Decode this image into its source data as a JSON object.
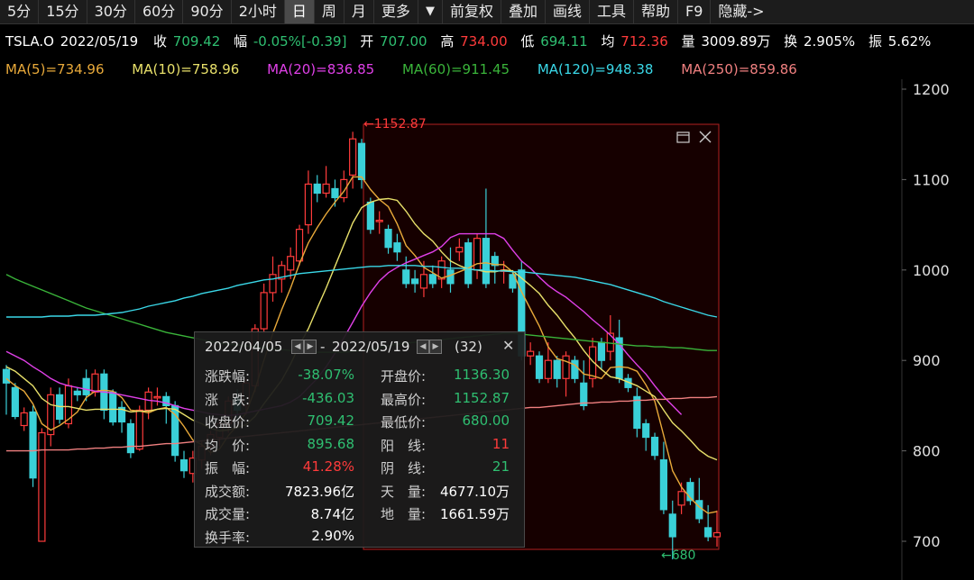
{
  "toolbar": {
    "periods": [
      "5分",
      "15分",
      "30分",
      "60分",
      "90分",
      "2小时",
      "日",
      "周",
      "月",
      "更多"
    ],
    "active": "日",
    "dropdown": "▼",
    "tools": [
      "前复权",
      "叠加",
      "画线",
      "工具",
      "帮助",
      "F9",
      "隐藏->"
    ]
  },
  "quote": {
    "symbol": "TSLA.O",
    "date": "2022/05/19",
    "close_label": "收",
    "close": "709.42",
    "change_label": "幅",
    "change": "-0.05%[-0.39]",
    "open_label": "开",
    "open": "707.00",
    "high_label": "高",
    "high": "734.00",
    "low_label": "低",
    "low": "694.11",
    "avg_label": "均",
    "avg": "712.36",
    "volume_label": "量",
    "volume": "3009.89万",
    "turnover_label": "换",
    "turnover": "2.905%",
    "amplitude_label": "振",
    "amplitude": "5.62%"
  },
  "ma_labels": [
    {
      "text": "MA(5)=734.96",
      "color": "#e8a93a"
    },
    {
      "text": "MA(10)=758.96",
      "color": "#e8e06a"
    },
    {
      "text": "MA(20)=836.85",
      "color": "#e040e8"
    },
    {
      "text": "MA(60)=911.45",
      "color": "#3ab43a"
    },
    {
      "text": "MA(120)=948.38",
      "color": "#3ad8e8"
    },
    {
      "text": "MA(250)=859.86",
      "color": "#f08080"
    }
  ],
  "colors": {
    "up": "#ff3b3b",
    "down": "#3ad0d8",
    "green_text": "#2fbf71",
    "red_text": "#ff3b3b"
  },
  "markers": {
    "high": "←1152.87",
    "low": "←680"
  },
  "chart_data": {
    "type": "candlestick",
    "ylim": [
      680,
      1200
    ],
    "yticks": [
      1200,
      1100,
      1000,
      900,
      800,
      700
    ],
    "candles": [
      [
        890,
        875,
        895,
        840
      ],
      [
        870,
        838,
        875,
        835
      ],
      [
        828,
        842,
        848,
        822
      ],
      [
        843,
        770,
        850,
        760
      ],
      [
        700,
        820,
        825,
        700
      ],
      [
        818,
        862,
        870,
        805
      ],
      [
        862,
        835,
        870,
        830
      ],
      [
        830,
        872,
        880,
        825
      ],
      [
        866,
        862,
        870,
        855
      ],
      [
        880,
        862,
        890,
        855
      ],
      [
        865,
        885,
        890,
        860
      ],
      [
        885,
        845,
        890,
        835
      ],
      [
        865,
        832,
        868,
        828
      ],
      [
        848,
        832,
        855,
        820
      ],
      [
        830,
        798,
        835,
        792
      ],
      [
        802,
        845,
        850,
        800
      ],
      [
        845,
        865,
        870,
        835
      ],
      [
        860,
        860,
        870,
        850
      ],
      [
        860,
        850,
        865,
        830
      ],
      [
        850,
        795,
        855,
        788
      ],
      [
        790,
        778,
        800,
        770
      ],
      [
        775,
        792,
        800,
        765
      ],
      [
        790,
        805,
        810,
        780
      ],
      [
        805,
        818,
        822,
        795
      ],
      [
        815,
        830,
        835,
        805
      ],
      [
        830,
        855,
        860,
        820
      ],
      [
        858,
        845,
        868,
        835
      ],
      [
        850,
        875,
        880,
        840
      ],
      [
        872,
        935,
        940,
        865
      ],
      [
        935,
        975,
        985,
        930
      ],
      [
        975,
        995,
        1015,
        965
      ],
      [
        990,
        1005,
        1010,
        975
      ],
      [
        1000,
        1015,
        1025,
        990
      ],
      [
        1010,
        1045,
        1050,
        1005
      ],
      [
        1050,
        1095,
        1110,
        1040
      ],
      [
        1095,
        1085,
        1105,
        1075
      ],
      [
        1085,
        1095,
        1115,
        1080
      ],
      [
        1090,
        1080,
        1100,
        1070
      ],
      [
        1080,
        1100,
        1110,
        1075
      ],
      [
        1105,
        1145,
        1152.87,
        1090
      ],
      [
        1140,
        1100,
        1145,
        1090
      ],
      [
        1075,
        1045,
        1080,
        1040
      ],
      [
        1055,
        1055,
        1065,
        1040
      ],
      [
        1045,
        1025,
        1050,
        1018
      ],
      [
        1030,
        1020,
        1040,
        1010
      ],
      [
        1000,
        985,
        1015,
        980
      ],
      [
        990,
        985,
        1000,
        975
      ],
      [
        980,
        995,
        1010,
        970
      ],
      [
        995,
        985,
        1005,
        980
      ],
      [
        990,
        1010,
        1015,
        980
      ],
      [
        1000,
        985,
        1025,
        975
      ],
      [
        1020,
        1025,
        1035,
        1010
      ],
      [
        1030,
        985,
        1035,
        980
      ],
      [
        1000,
        1035,
        1040,
        990
      ],
      [
        1035,
        985,
        1090,
        980
      ],
      [
        1015,
        1005,
        1020,
        985
      ],
      [
        1000,
        1000,
        1010,
        985
      ],
      [
        995,
        980,
        1000,
        975
      ],
      [
        1000,
        905,
        1010,
        900
      ],
      [
        905,
        910,
        920,
        895
      ],
      [
        905,
        880,
        910,
        875
      ],
      [
        880,
        900,
        920,
        875
      ],
      [
        900,
        880,
        905,
        870
      ],
      [
        880,
        905,
        910,
        860
      ],
      [
        900,
        880,
        905,
        875
      ],
      [
        875,
        850,
        900,
        845
      ],
      [
        880,
        915,
        925,
        870
      ],
      [
        920,
        900,
        925,
        890
      ],
      [
        910,
        930,
        950,
        900
      ],
      [
        925,
        880,
        945,
        875
      ],
      [
        880,
        870,
        885,
        865
      ],
      [
        860,
        825,
        870,
        815
      ],
      [
        830,
        815,
        835,
        800
      ],
      [
        815,
        795,
        820,
        790
      ],
      [
        790,
        735,
        810,
        730
      ],
      [
        730,
        705,
        745,
        680
      ],
      [
        740,
        755,
        765,
        730
      ],
      [
        765,
        745,
        770,
        740
      ],
      [
        745,
        725,
        770,
        720
      ],
      [
        715,
        705,
        740,
        700
      ],
      [
        705,
        709.42,
        734,
        694.11
      ]
    ],
    "ma": [
      {
        "name": "MA(5)",
        "color": "#e8a93a",
        "values": [
          880,
          872,
          866,
          852,
          830,
          823,
          828,
          835,
          843,
          859,
          866,
          867,
          866,
          859,
          845,
          844,
          842,
          846,
          848,
          840,
          827,
          812,
          807,
          798,
          802,
          817,
          828,
          842,
          868,
          900,
          930,
          956,
          980,
          1007,
          1030,
          1047,
          1062,
          1075,
          1087,
          1103,
          1103,
          1089,
          1078,
          1070,
          1051,
          1027,
          1016,
          1003,
          997,
          991,
          994,
          998,
          1002,
          1007,
          1008,
          1006,
          1006,
          998,
          976,
          957,
          938,
          915,
          902,
          899,
          895,
          885,
          883,
          880,
          892,
          893,
          892,
          888,
          873,
          855,
          817,
          778,
          760,
          748,
          738,
          731,
          733
        ]
      },
      {
        "name": "MA(10)",
        "color": "#e8e06a",
        "values": [
          893,
          888,
          880,
          872,
          858,
          851,
          849,
          849,
          847,
          845,
          846,
          846,
          846,
          846,
          843,
          844,
          844,
          846,
          847,
          846,
          840,
          834,
          830,
          825,
          822,
          823,
          826,
          829,
          838,
          852,
          865,
          878,
          896,
          917,
          935,
          958,
          980,
          1004,
          1028,
          1052,
          1069,
          1075,
          1078,
          1079,
          1077,
          1065,
          1051,
          1040,
          1032,
          1020,
          1010,
          1005,
          1001,
          1000,
          998,
          998,
          1000,
          999,
          991,
          983,
          974,
          961,
          950,
          937,
          925,
          911,
          899,
          890,
          882,
          880,
          876,
          872,
          866,
          860,
          845,
          831,
          822,
          812,
          801,
          794,
          790
        ]
      },
      {
        "name": "MA(20)",
        "color": "#e040e8",
        "values": [
          910,
          905,
          900,
          893,
          887,
          880,
          875,
          872,
          870,
          868,
          866,
          865,
          864,
          862,
          860,
          858,
          856,
          855,
          853,
          850,
          847,
          845,
          843,
          841,
          840,
          839,
          840,
          842,
          844,
          846,
          848,
          850,
          854,
          860,
          870,
          880,
          893,
          908,
          925,
          942,
          960,
          975,
          988,
          997,
          1003,
          1008,
          1012,
          1016,
          1020,
          1026,
          1036,
          1040,
          1040,
          1040,
          1040,
          1040,
          1035,
          1022,
          1010,
          1002,
          992,
          983,
          976,
          970,
          962,
          954,
          945,
          937,
          928,
          918,
          906,
          895,
          885,
          872,
          860,
          850,
          840
        ]
      },
      {
        "name": "MA(60)",
        "color": "#3ab43a",
        "values": [
          995,
          990,
          986,
          982,
          978,
          974,
          970,
          966,
          962,
          958,
          955,
          952,
          949,
          946,
          943,
          940,
          937,
          934,
          931,
          929,
          927,
          925,
          923,
          921,
          919,
          918,
          917,
          916,
          915,
          914,
          913,
          912,
          911,
          910,
          910,
          909,
          909,
          909,
          909,
          910,
          911,
          912,
          914,
          916,
          918,
          919,
          920,
          921,
          922,
          923,
          924,
          925,
          926,
          927,
          928,
          929,
          930,
          930,
          929,
          928,
          927,
          926,
          925,
          924,
          923,
          922,
          921,
          920,
          919,
          918,
          917,
          916,
          916,
          915,
          915,
          914,
          914,
          913,
          912,
          911,
          911
        ]
      },
      {
        "name": "MA(120)",
        "color": "#3ad8e8",
        "values": [
          948,
          948,
          948,
          948,
          948,
          949,
          949,
          949,
          950,
          950,
          950,
          951,
          952,
          953,
          955,
          957,
          960,
          962,
          964,
          966,
          969,
          971,
          974,
          976,
          978,
          980,
          983,
          985,
          987,
          989,
          990,
          992,
          994,
          996,
          997,
          998,
          999,
          1000,
          1001,
          1002,
          1003,
          1004,
          1004,
          1005,
          1005,
          1005,
          1005,
          1004,
          1004,
          1003,
          1002,
          1002,
          1001,
          1000,
          1000,
          999,
          999,
          998,
          998,
          997,
          996,
          995,
          994,
          993,
          992,
          990,
          988,
          986,
          984,
          981,
          978,
          975,
          972,
          969,
          965,
          962,
          959,
          956,
          953,
          950,
          948
        ]
      },
      {
        "name": "MA(250)",
        "color": "#f08080",
        "values": [
          800,
          800,
          800,
          800,
          801,
          801,
          801,
          801,
          802,
          802,
          803,
          803,
          804,
          804,
          805,
          805,
          806,
          807,
          808,
          808,
          809,
          810,
          811,
          812,
          813,
          814,
          815,
          816,
          817,
          818,
          819,
          820,
          821,
          822,
          823,
          824,
          825,
          826,
          827,
          828,
          829,
          830,
          831,
          832,
          833,
          834,
          835,
          836,
          837,
          838,
          839,
          840,
          841,
          842,
          843,
          844,
          845,
          846,
          847,
          848,
          848,
          849,
          850,
          851,
          852,
          853,
          853,
          854,
          854,
          855,
          855,
          856,
          856,
          857,
          857,
          858,
          858,
          859,
          859,
          859,
          860
        ]
      }
    ]
  },
  "range_panel": {
    "start_date": "2022/04/05",
    "separator": "-",
    "end_date": "2022/05/19",
    "count": "(32)",
    "close_label": "✕",
    "rows": [
      {
        "l1": "涨跌幅:",
        "v1": "-38.07%",
        "c1": "#2fbf71",
        "l2": "开盘价:",
        "v2": "1136.30",
        "c2": "#2fbf71"
      },
      {
        "l1": "涨　跌:",
        "v1": "-436.03",
        "c1": "#2fbf71",
        "l2": "最高价:",
        "v2": "1152.87",
        "c2": "#2fbf71"
      },
      {
        "l1": "收盘价:",
        "v1": "709.42",
        "c1": "#2fbf71",
        "l2": "最低价:",
        "v2": "680.00",
        "c2": "#2fbf71"
      },
      {
        "l1": "均　价:",
        "v1": "895.68",
        "c1": "#2fbf71",
        "l2": "阳　线:",
        "v2": "11",
        "c2": "#ff3b3b"
      },
      {
        "l1": "振　幅:",
        "v1": "41.28%",
        "c1": "#ff3b3b",
        "l2": "阴　线:",
        "v2": "21",
        "c2": "#2fbf71"
      },
      {
        "l1": "成交额:",
        "v1": "7823.96亿",
        "c1": "#ffffff",
        "l2": "天　量:",
        "v2": "4677.10万",
        "c2": "#ffffff"
      },
      {
        "l1": "成交量:",
        "v1": "8.74亿",
        "c1": "#ffffff",
        "l2": "地　量:",
        "v2": "1661.59万",
        "c2": "#ffffff"
      },
      {
        "l1": "换手率:",
        "v1": "2.90%",
        "c1": "#ffffff",
        "l2": "",
        "v2": "",
        "c2": "#ffffff"
      }
    ]
  }
}
